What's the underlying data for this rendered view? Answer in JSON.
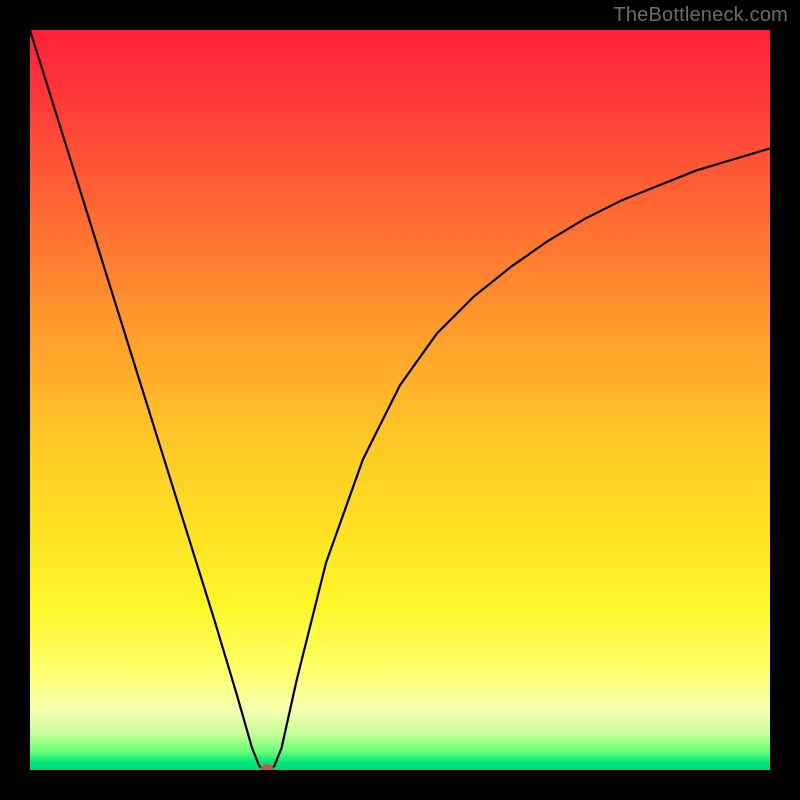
{
  "watermark": "TheBottleneck.com",
  "chart_data": {
    "type": "line",
    "title": "",
    "xlabel": "",
    "ylabel": "",
    "xlim": [
      0,
      100
    ],
    "ylim": [
      0,
      100
    ],
    "series": [
      {
        "name": "bottleneck-curve",
        "x": [
          0,
          5,
          10,
          15,
          20,
          25,
          28,
          30,
          31,
          32,
          33,
          34,
          36,
          40,
          45,
          50,
          55,
          60,
          65,
          70,
          75,
          80,
          85,
          90,
          95,
          100
        ],
        "values": [
          100,
          84,
          68,
          52,
          36,
          20,
          10,
          3,
          0.5,
          0,
          0.5,
          3,
          12,
          28,
          42,
          52,
          59,
          64,
          68,
          71.5,
          74.5,
          77,
          79,
          81,
          82.5,
          84
        ]
      }
    ],
    "marker": {
      "x": 32,
      "y": 0
    },
    "colors": {
      "curve": "#000000",
      "marker": "#c45a4a",
      "gradient_top": "#ff1f3a",
      "gradient_bottom": "#00d878"
    }
  }
}
